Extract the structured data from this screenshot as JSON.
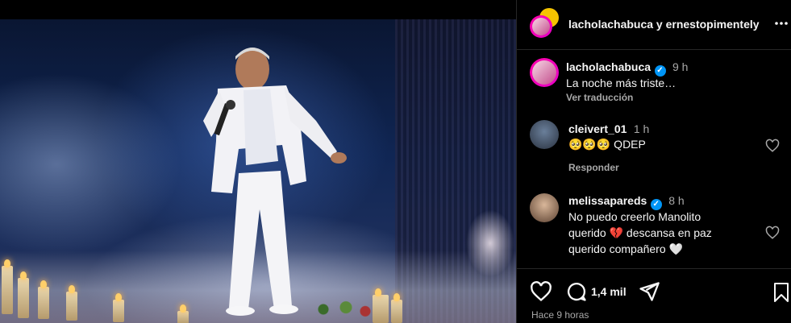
{
  "post": {
    "authors": "lacholachabuca y ernestopimentely",
    "more_icon": "more-horizontal-icon"
  },
  "caption": {
    "username": "lacholachabuca",
    "time": "9 h",
    "text": "La noche más triste…",
    "translate": "Ver traducción"
  },
  "comments": [
    {
      "username": "cleivert_01",
      "time": "1 h",
      "text": "🥺🥺🥺 QDEP",
      "reply": "Responder"
    },
    {
      "username": "melissapareds",
      "verified": true,
      "time": "8 h",
      "text_line1": "No puedo creerlo Manolito",
      "text_line2": "querido 💔 descansa en paz",
      "text_line3": "querido compañero 🤍"
    }
  ],
  "actions": {
    "comment_count": "1,4 mil",
    "timestamp": "Hace 9 horas"
  },
  "colors": {
    "accent_blue": "#0095f6",
    "story_ring": "#ff00aa"
  }
}
